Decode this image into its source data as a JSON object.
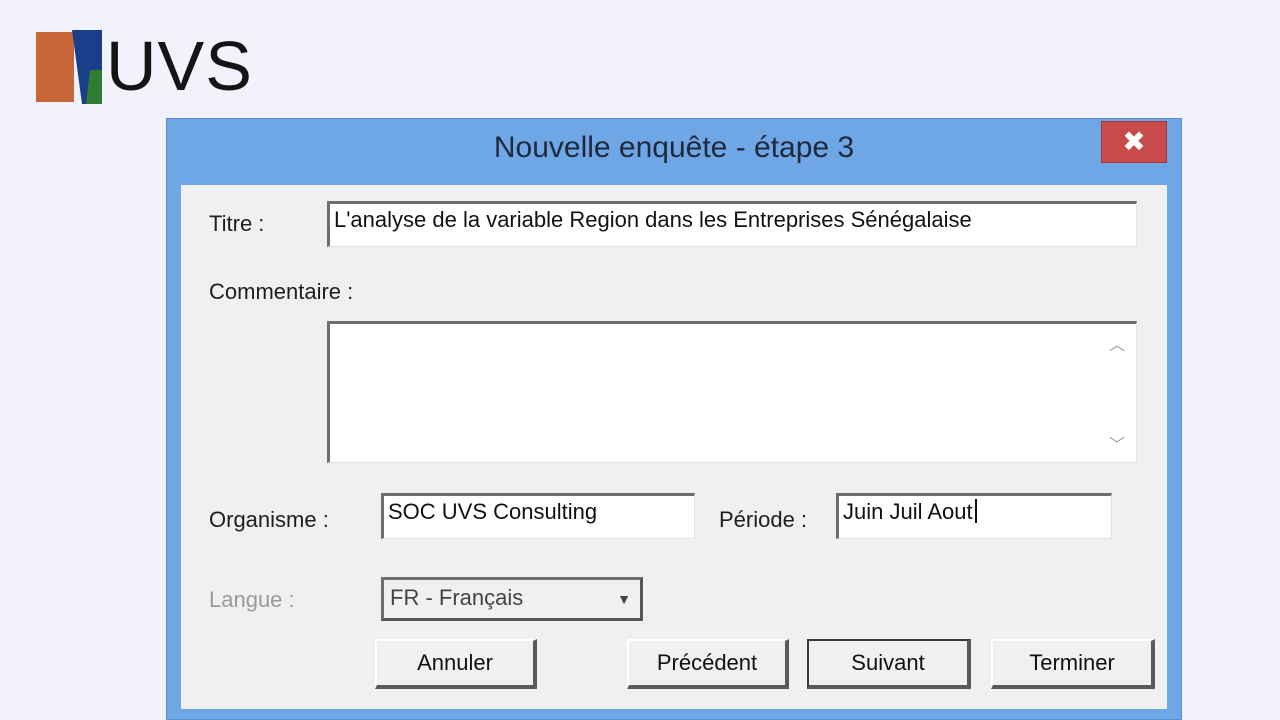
{
  "logo": {
    "text": "UVS",
    "colors": {
      "orange": "#c8663a",
      "blue": "#1a3e8a",
      "green": "#2e7d32"
    }
  },
  "dialog": {
    "title": "Nouvelle enquête - étape 3",
    "close_icon": "close-icon",
    "close_glyph": "✖",
    "accent": "#6fa6e6"
  },
  "form": {
    "titre": {
      "label": "Titre :",
      "value": "L'analyse de la variable Region dans les Entreprises Sénégalaise"
    },
    "commentaire": {
      "label": "Commentaire :",
      "value": ""
    },
    "organisme": {
      "label": "Organisme :",
      "value": "SOC UVS Consulting"
    },
    "periode": {
      "label": "Période :",
      "value": "Juin Juil Aout"
    },
    "langue": {
      "label": "Langue :",
      "selected": "FR - Français"
    }
  },
  "buttons": {
    "annuler": "Annuler",
    "precedent": "Précédent",
    "suivant": "Suivant",
    "terminer": "Terminer"
  }
}
